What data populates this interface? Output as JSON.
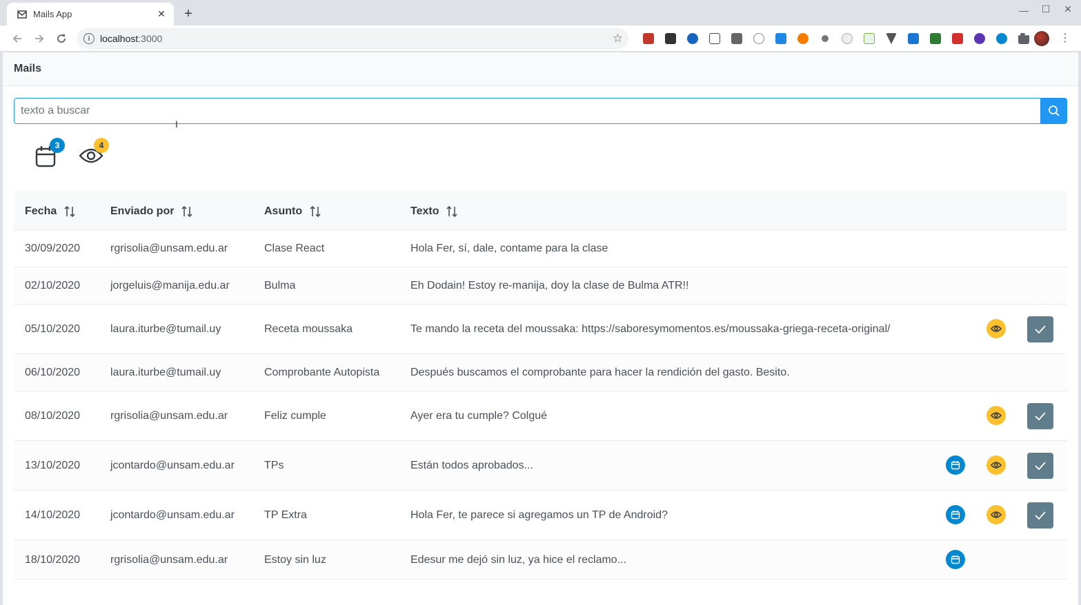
{
  "browser": {
    "tab_title": "Mails App",
    "url_host": "localhost",
    "url_port": ":3000"
  },
  "app": {
    "title": "Mails"
  },
  "search": {
    "placeholder": "texto a buscar"
  },
  "filters": {
    "calendar_count": "3",
    "eye_count": "4"
  },
  "table": {
    "headers": [
      "Fecha",
      "Enviado por",
      "Asunto",
      "Texto"
    ],
    "rows": [
      {
        "date": "30/09/2020",
        "from": "rgrisolia@unsam.edu.ar",
        "subject": "Clase React",
        "text": "Hola Fer, sí, dale, contame para la clase",
        "cal": false,
        "eye": false,
        "check": false
      },
      {
        "date": "02/10/2020",
        "from": "jorgeluis@manija.edu.ar",
        "subject": "Bulma",
        "text": "Eh Dodain! Estoy re-manija, doy la clase de Bulma ATR!!",
        "cal": false,
        "eye": false,
        "check": false
      },
      {
        "date": "05/10/2020",
        "from": "laura.iturbe@tumail.uy",
        "subject": "Receta moussaka",
        "text": "Te mando la receta del moussaka: https://saboresymomentos.es/moussaka-griega-receta-original/",
        "cal": false,
        "eye": true,
        "check": true
      },
      {
        "date": "06/10/2020",
        "from": "laura.iturbe@tumail.uy",
        "subject": "Comprobante Autopista",
        "text": "Después buscamos el comprobante para hacer la rendición del gasto. Besito.",
        "cal": false,
        "eye": false,
        "check": false
      },
      {
        "date": "08/10/2020",
        "from": "rgrisolia@unsam.edu.ar",
        "subject": "Feliz cumple",
        "text": "Ayer era tu cumple? Colgué",
        "cal": false,
        "eye": true,
        "check": true
      },
      {
        "date": "13/10/2020",
        "from": "jcontardo@unsam.edu.ar",
        "subject": "TPs",
        "text": "Están todos aprobados...",
        "cal": true,
        "eye": true,
        "check": true
      },
      {
        "date": "14/10/2020",
        "from": "jcontardo@unsam.edu.ar",
        "subject": "TP Extra",
        "text": "Hola Fer, te parece si agregamos un TP de Android?",
        "cal": true,
        "eye": true,
        "check": true
      },
      {
        "date": "18/10/2020",
        "from": "rgrisolia@unsam.edu.ar",
        "subject": "Estoy sin luz",
        "text": "Edesur me dejó sin luz, ya hice el reclamo...",
        "cal": true,
        "eye": false,
        "check": false
      }
    ]
  },
  "colors": {
    "primary": "#2196f3",
    "calendar": "#0288d1",
    "eye": "#fbc02d",
    "check": "#607d8b"
  }
}
